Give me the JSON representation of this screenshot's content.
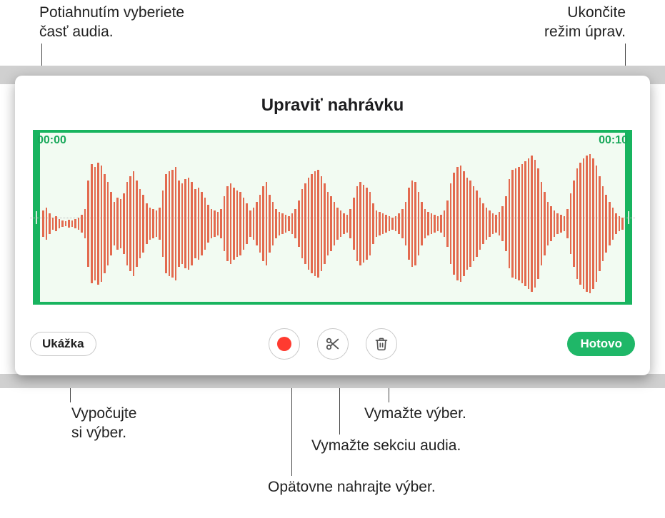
{
  "callouts": {
    "drag_select": "Potiahnutím vyberiete\nčasť audia.",
    "exit_edit": "Ukončite\nrežim úprav.",
    "preview": "Vypočujte\nsi výber.",
    "rerecord": "Opätovne nahrajte výber.",
    "cut": "Vymažte sekciu audia.",
    "delete": "Vymažte výber."
  },
  "panel": {
    "title": "Upraviť nahrávku",
    "time_start": "00:00",
    "time_end": "00:10",
    "preview_button": "Ukážka",
    "done_button": "Hotovo"
  },
  "icons": {
    "record": "record-icon",
    "scissors": "scissors-icon",
    "trash": "trash-icon"
  },
  "colors": {
    "accent_green": "#1fb768",
    "waveform": "#e36a4f",
    "record_red": "#ff3b30"
  },
  "waveform": {
    "bars": [
      18,
      22,
      14,
      8,
      10,
      6,
      4,
      3,
      5,
      4,
      6,
      8,
      12,
      20,
      60,
      82,
      78,
      84,
      80,
      68,
      58,
      44,
      30,
      36,
      34,
      42,
      58,
      66,
      72,
      60,
      48,
      40,
      28,
      22,
      20,
      18,
      22,
      46,
      68,
      72,
      74,
      78,
      60,
      56,
      62,
      64,
      58,
      48,
      50,
      44,
      36,
      26,
      20,
      18,
      16,
      20,
      38,
      52,
      56,
      50,
      46,
      44,
      36,
      28,
      18,
      22,
      30,
      40,
      52,
      58,
      40,
      30,
      20,
      16,
      14,
      12,
      10,
      14,
      20,
      32,
      48,
      56,
      64,
      68,
      72,
      74,
      66,
      56,
      44,
      38,
      30,
      22,
      18,
      14,
      12,
      20,
      36,
      52,
      58,
      54,
      50,
      44,
      28,
      18,
      16,
      14,
      12,
      10,
      8,
      10,
      14,
      20,
      30,
      50,
      60,
      58,
      44,
      30,
      20,
      16,
      14,
      12,
      10,
      12,
      18,
      32,
      56,
      70,
      78,
      80,
      72,
      64,
      60,
      52,
      46,
      36,
      28,
      22,
      18,
      14,
      12,
      16,
      24,
      38,
      62,
      74,
      76,
      78,
      82,
      86,
      90,
      94,
      88,
      76,
      58,
      44,
      30,
      24,
      18,
      14,
      12,
      10,
      20,
      42,
      60,
      76,
      84,
      90,
      94,
      96,
      90,
      80,
      66,
      52,
      40,
      30,
      22,
      14,
      10,
      8
    ]
  }
}
